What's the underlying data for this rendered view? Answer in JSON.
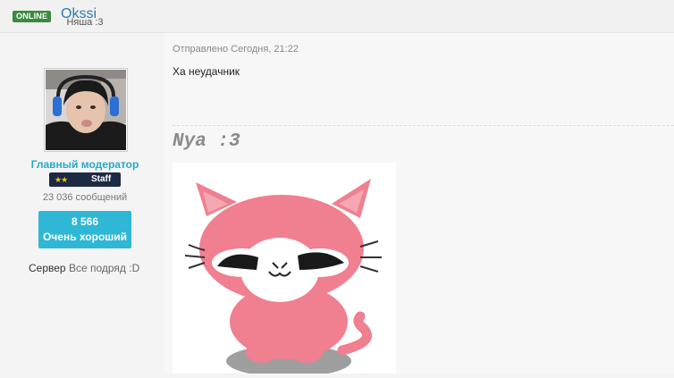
{
  "header": {
    "status_badge": "ONLINE",
    "username": "Okssi"
  },
  "user": {
    "title": "Няша :3",
    "role": "Главный модератор",
    "badge_stars": "★★",
    "badge_label": "Staff",
    "message_count": "23 036 сообщений",
    "reputation_value": "8 566",
    "reputation_label": "Очень хороший",
    "server_label": "Сервер",
    "server_value": "Все подряд :D"
  },
  "post": {
    "meta": "Отправлено Сегодня, 21:22",
    "text": "Ха неудачник"
  },
  "signature": {
    "title": "Nya :3"
  },
  "colors": {
    "online": "#3b8a3e",
    "username": "#2b7ba8",
    "role": "#28a9c9",
    "reputation_bg": "#2fb7d6",
    "staff_bg": "#1d2a44",
    "cat_pink": "#f07f8f"
  }
}
